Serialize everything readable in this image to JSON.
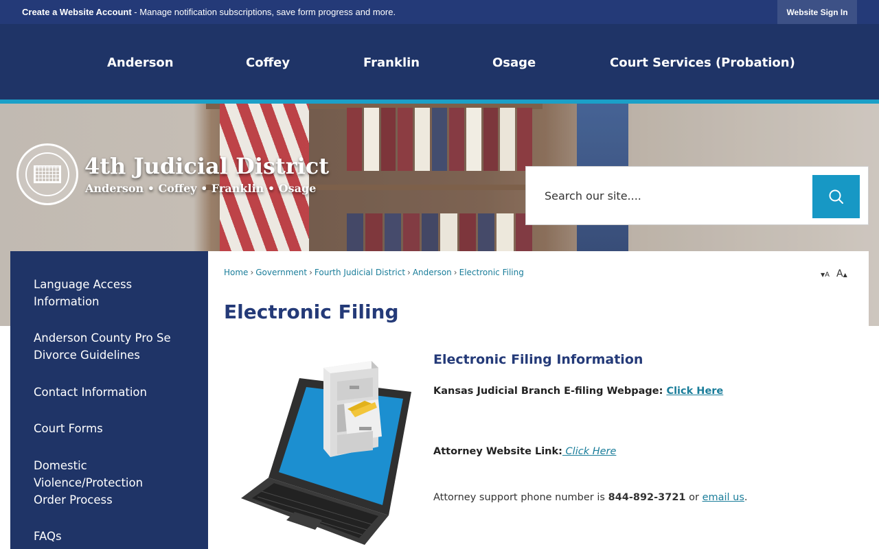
{
  "topbar": {
    "account_bold": "Create a Website Account",
    "account_rest": " - Manage notification subscriptions, save form progress and more.",
    "signin_label": "Website Sign In"
  },
  "nav": {
    "items": [
      "Anderson",
      "Coffey",
      "Franklin",
      "Osage",
      "Court Services (Probation)"
    ]
  },
  "brand": {
    "title": "4th Judicial District",
    "subtitle": "Anderson • Coffey • Franklin • Osage"
  },
  "search": {
    "placeholder": "Search our site....",
    "icon": "search-icon"
  },
  "sidebar": {
    "items": [
      "Language Access Information",
      "Anderson County Pro Se Divorce Guidelines",
      "Contact Information",
      "Court Forms",
      "Domestic Violence/Protection Order Process",
      "FAQs"
    ]
  },
  "breadcrumb": [
    "Home",
    "Government",
    "Fourth Judicial District",
    "Anderson",
    "Electronic Filing"
  ],
  "text_size": {
    "decrease": "A",
    "increase": "A"
  },
  "main": {
    "title": "Electronic Filing",
    "section_title": "Electronic Filing Information",
    "efiling_label": "Kansas Judicial Branch E-filing Webpage: ",
    "efiling_link": "Click Here",
    "attorney_label": "Attorney Website Link:",
    "attorney_link": " Click Here",
    "support_prefix": "Attorney support phone number is ",
    "support_phone": "844-892-3721",
    "support_middle": " or ",
    "support_link": "email us",
    "support_suffix": "."
  },
  "colors": {
    "navy": "#1f3467",
    "topbar": "#243a78",
    "accent": "#1798c5",
    "link": "#1a7d9a"
  }
}
